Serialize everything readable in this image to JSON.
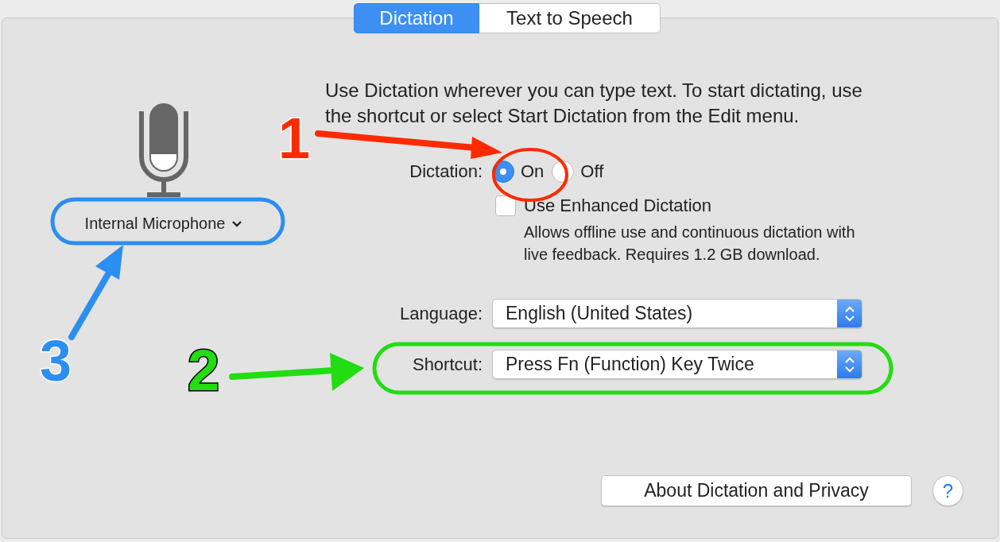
{
  "tabs": [
    {
      "label": "Dictation",
      "selected": true
    },
    {
      "label": "Text to Speech",
      "selected": false
    }
  ],
  "microphone": {
    "device": "Internal Microphone"
  },
  "description": "Use Dictation wherever you can type text. To start dictating, use the shortcut or select Start Dictation from the Edit menu.",
  "dictation": {
    "label": "Dictation:",
    "options": [
      {
        "label": "On",
        "selected": true
      },
      {
        "label": "Off",
        "selected": false
      }
    ]
  },
  "enhanced": {
    "label": "Use Enhanced Dictation",
    "checked": false,
    "note": "Allows offline use and continuous dictation with live feedback. Requires 1.2 GB download."
  },
  "language": {
    "label": "Language:",
    "value": "English (United States)"
  },
  "shortcut": {
    "label": "Shortcut:",
    "value": "Press Fn (Function) Key Twice"
  },
  "about_button": "About Dictation and Privacy",
  "help_button": "?",
  "annotations": [
    {
      "number": "1",
      "color": "#ff2a00"
    },
    {
      "number": "2",
      "color": "#22dd11"
    },
    {
      "number": "3",
      "color": "#2b8ef0"
    }
  ]
}
